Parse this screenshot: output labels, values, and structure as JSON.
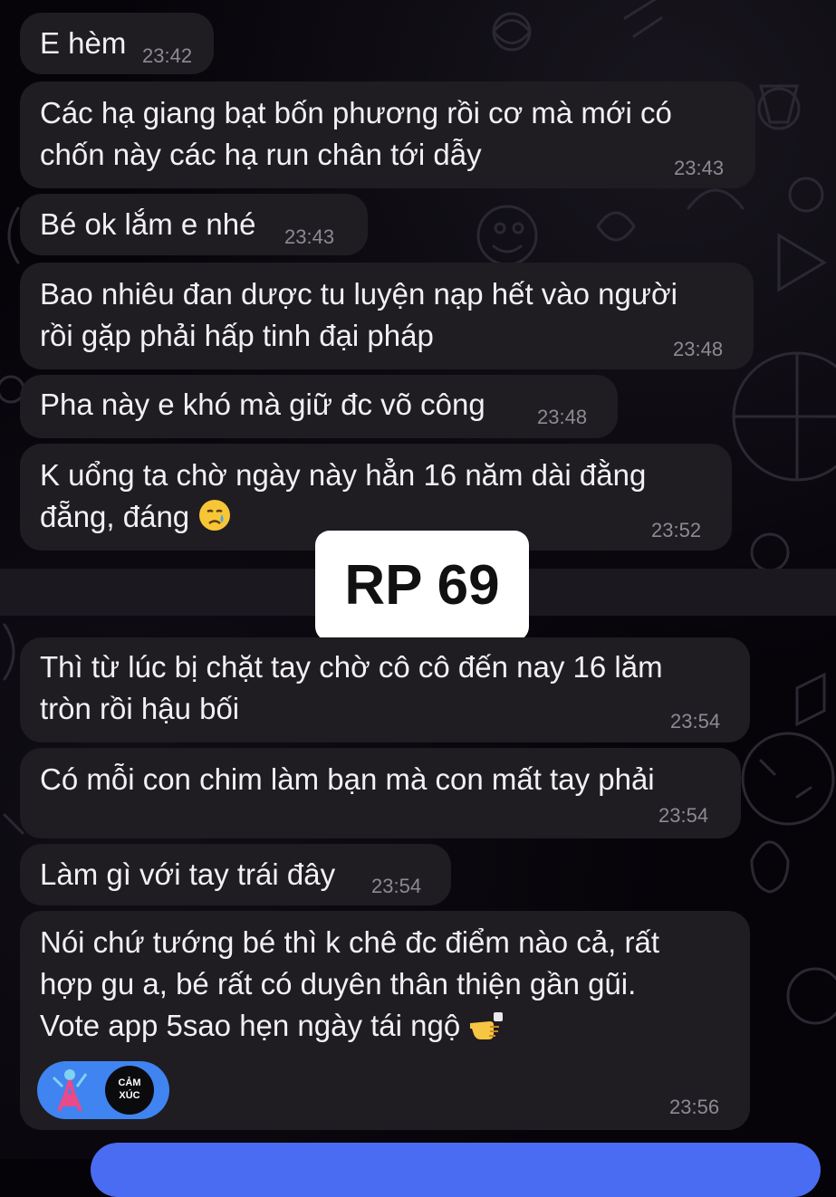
{
  "messages": [
    {
      "text": "E hèm",
      "time": "23:42"
    },
    {
      "text": "Các hạ giang bạt bốn phương rồi cơ mà mới có\nchốn này các hạ run chân tới dẫy",
      "time": "23:43"
    },
    {
      "text": "Bé ok lắm e nhé",
      "time": "23:43"
    },
    {
      "text": "Bao nhiêu đan dược tu luyện nạp hết vào người\nrồi gặp phải hấp tinh đại pháp",
      "time": "23:48"
    },
    {
      "text": "Pha này e khó mà giữ đc võ công",
      "time": "23:48"
    },
    {
      "text": "K uổng ta chờ ngày này hẳn 16 năm dài đằng",
      "text2": "đẵng, đáng",
      "emoji": "crying-face",
      "time": "23:52"
    },
    {
      "text": "Thì từ lúc bị chặt tay chờ cô cô đến nay 16 lăm\ntròn rồi hậu bối",
      "time": "23:54"
    },
    {
      "text": "Có mỗi con chim làm bạn mà con mất tay phải",
      "time": "23:54"
    },
    {
      "text": "Làm gì với tay trái đây",
      "time": "23:54"
    },
    {
      "text": "Nói chứ tướng bé thì k chê đc điểm nào cả, rất\nhợp gu a, bé rất có duyên thân thiện gần gũi.",
      "text2": "Vote app 5sao hẹn ngày tái ngộ",
      "emoji": "pointing-hand",
      "time": "23:56"
    }
  ],
  "overlay": {
    "label": "RP 69"
  },
  "reaction": {
    "label_line1": "CẢM",
    "label_line2": "XÚC"
  },
  "colors": {
    "background": "#060409",
    "bubble": "#1f1c22",
    "text": "#f2f0f4",
    "time": "#8e8a93",
    "reaction_pill": "#3f84f0",
    "composer": "#4a6cf2"
  }
}
